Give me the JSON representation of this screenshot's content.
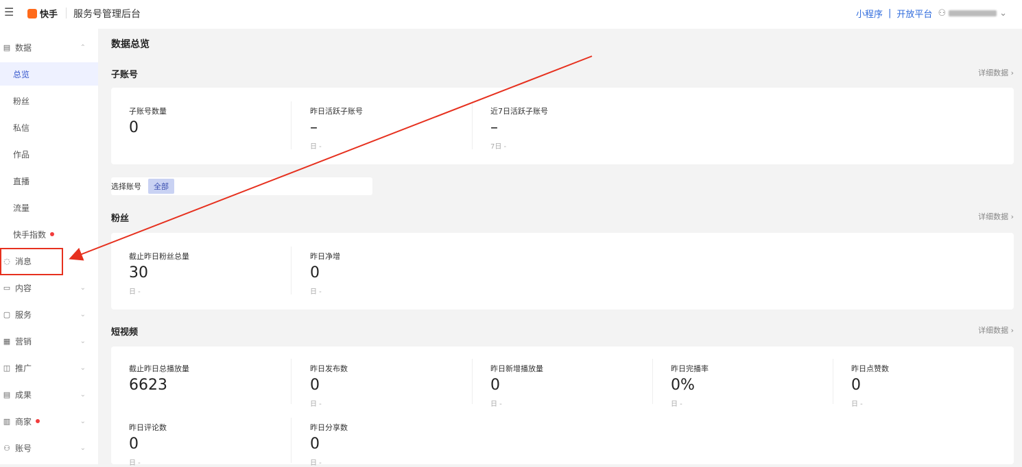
{
  "header": {
    "menu_icon": "☰",
    "brand": "快手",
    "title": "服务号管理后台",
    "links": [
      "小程序",
      "开放平台"
    ],
    "separator": "|",
    "user_chevron": "⌄"
  },
  "sidebar": {
    "items": [
      {
        "label": "数据",
        "icon": "chart-icon",
        "expanded": true
      },
      {
        "label": "总览",
        "active": true
      },
      {
        "label": "粉丝"
      },
      {
        "label": "私信"
      },
      {
        "label": "作品"
      },
      {
        "label": "直播"
      },
      {
        "label": "流量"
      },
      {
        "label": "快手指数",
        "dot": true
      },
      {
        "label": "消息",
        "icon": "message-icon"
      },
      {
        "label": "内容",
        "icon": "content-icon"
      },
      {
        "label": "服务",
        "icon": "service-icon"
      },
      {
        "label": "营销",
        "icon": "marketing-icon"
      },
      {
        "label": "推广",
        "icon": "promote-icon"
      },
      {
        "label": "成果",
        "icon": "result-icon"
      },
      {
        "label": "商家",
        "icon": "store-icon",
        "dot": true
      },
      {
        "label": "账号",
        "icon": "account-icon"
      }
    ]
  },
  "page": {
    "title": "数据总览",
    "detail_label": "详细数据",
    "sections": {
      "sub_accounts": {
        "title": "子账号",
        "stats": [
          {
            "label": "子账号数量",
            "value": "0",
            "note": ""
          },
          {
            "label": "昨日活跃子账号",
            "value": "–",
            "note": "日 -"
          },
          {
            "label": "近7日活跃子账号",
            "value": "–",
            "note": "7日 -"
          }
        ]
      },
      "filter": {
        "label": "选择账号",
        "tag": "全部"
      },
      "fans": {
        "title": "粉丝",
        "stats": [
          {
            "label": "截止昨日粉丝总量",
            "value": "30",
            "note": "日 -"
          },
          {
            "label": "昨日净增",
            "value": "0",
            "note": "日 -"
          }
        ]
      },
      "short_video": {
        "title": "短视频",
        "stats": [
          {
            "label": "截止昨日总播放量",
            "value": "6623",
            "note": ""
          },
          {
            "label": "昨日发布数",
            "value": "0",
            "note": "日 -"
          },
          {
            "label": "昨日新增播放量",
            "value": "0",
            "note": "日 -"
          },
          {
            "label": "昨日完播率",
            "value": "0%",
            "note": "日 -"
          },
          {
            "label": "昨日点赞数",
            "value": "0",
            "note": "日 -"
          },
          {
            "label": "昨日评论数",
            "value": "0",
            "note": "日 -"
          },
          {
            "label": "昨日分享数",
            "value": "0",
            "note": "日 -"
          }
        ]
      }
    }
  },
  "annotation": {
    "color": "#e6301e"
  }
}
